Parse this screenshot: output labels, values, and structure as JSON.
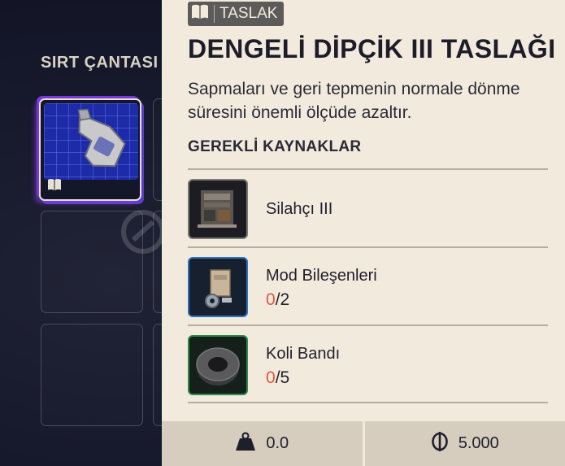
{
  "backpack": {
    "title": "SIRT ÇANTASI"
  },
  "tooltip": {
    "badge_label": "TASLAK",
    "badge_icon": "book-icon",
    "title": "DENGELİ DİPÇİK III TASLAĞI",
    "description": "Sapmaları ve geri tepmenin normale dönme süresini önemli ölçüde azaltır.",
    "requirements_header": "GEREKLİ KAYNAKLAR",
    "requirements": [
      {
        "name": "Silahçı III",
        "have": null,
        "need": null,
        "rarity": "gray",
        "icon": "workbench-icon"
      },
      {
        "name": "Mod Bileşenleri",
        "have": "0",
        "need": "/2",
        "rarity": "blue",
        "icon": "mod-components-icon"
      },
      {
        "name": "Koli Bandı",
        "have": "0",
        "need": "/5",
        "rarity": "green",
        "icon": "duct-tape-icon"
      }
    ]
  },
  "footer": {
    "weight": "0.0",
    "weight_icon": "weight-icon",
    "price": "5.000",
    "price_icon": "coin-icon"
  },
  "colors": {
    "panel": "#f2ebdd",
    "footer": "#d6cdbf",
    "missing": "#e0573f",
    "rarity_gray": "#7c7a76",
    "rarity_blue": "#2f71c5",
    "rarity_green": "#2c8b4a",
    "selection_glow": "#7a38d8"
  }
}
